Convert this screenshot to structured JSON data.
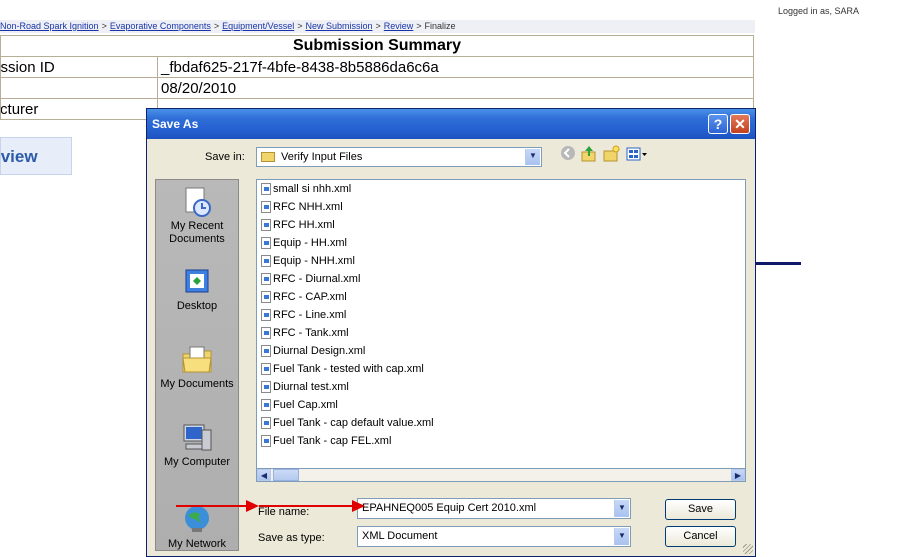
{
  "header": {
    "logged_in": "Logged in as, SARA"
  },
  "breadcrumb": {
    "items": [
      "Non-Road Spark Ignition",
      "Evaporative Components",
      "Equipment/Vessel",
      "New Submission",
      "Review"
    ],
    "separator": ">",
    "current": "Finalize"
  },
  "summary": {
    "title": "Submission Summary",
    "rows": [
      {
        "label": "Submission ID",
        "value": "_fbdaf625-217f-4bfe-8438-8b5886da6c6a"
      },
      {
        "label": "",
        "value": "08/20/2010"
      },
      {
        "label": "Manufacturer",
        "value": ""
      }
    ],
    "review_tab": "Review"
  },
  "dialog": {
    "title": "Save As",
    "help_glyph": "?",
    "close_glyph": "✕",
    "save_in_label": "Save in:",
    "save_in_value": "Verify Input Files",
    "places": [
      "My Recent Documents",
      "Desktop",
      "My Documents",
      "My Computer",
      "My Network"
    ],
    "files": [
      "small si nhh.xml",
      "RFC NHH.xml",
      "RFC HH.xml",
      "Equip - HH.xml",
      "Equip - NHH.xml",
      "RFC - Diurnal.xml",
      "RFC - CAP.xml",
      "RFC - Line.xml",
      "RFC - Tank.xml",
      "Diurnal Design.xml",
      "Fuel Tank - tested with cap.xml",
      "Diurnal test.xml",
      "Fuel Cap.xml",
      "Fuel Tank - cap default value.xml",
      "Fuel Tank - cap FEL.xml"
    ],
    "file_name_label": "File name:",
    "file_name_value": "EPAHNEQ005 Equip Cert 2010.xml",
    "save_type_label": "Save as type:",
    "save_type_value": "XML Document",
    "save_button": "Save",
    "cancel_button": "Cancel"
  },
  "colors": {
    "title_bar": "#2f6fd8",
    "link": "#1a34a8",
    "annotation_arrow": "#e00000",
    "dialog_body": "#ece9d8"
  },
  "icons": {
    "toolbar": [
      "back-icon",
      "up-folder-icon",
      "new-folder-icon",
      "views-menu-icon"
    ],
    "places": [
      "recent-documents-icon",
      "desktop-icon",
      "my-documents-icon",
      "my-computer-icon",
      "network-icon"
    ]
  }
}
